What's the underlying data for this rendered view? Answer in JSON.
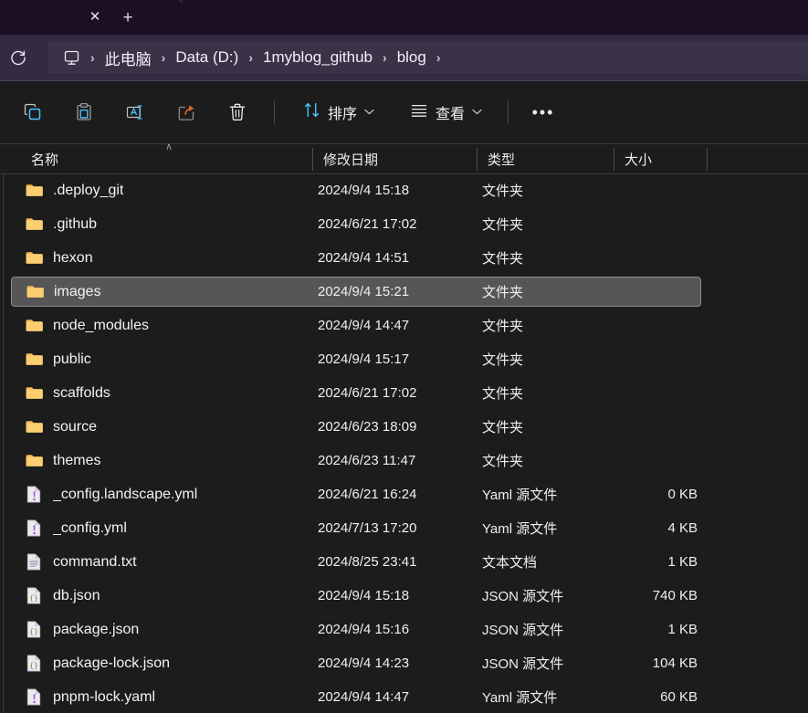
{
  "window": {
    "tab": {
      "close_label": "✕",
      "new_tab_label": "+"
    },
    "address": {
      "refresh_icon": "refresh-icon",
      "pc_icon": "this-pc-monitor-icon",
      "separator": "›",
      "crumbs": [
        "此电脑",
        "Data (D:)",
        "1myblog_github",
        "blog"
      ]
    }
  },
  "toolbar": {
    "icons": [
      {
        "name": "copy-icon",
        "label": "复制"
      },
      {
        "name": "paste-icon",
        "label": "粘贴"
      },
      {
        "name": "rename-icon",
        "label": "重命名"
      },
      {
        "name": "share-icon",
        "label": "共享"
      },
      {
        "name": "delete-icon",
        "label": "删除"
      }
    ],
    "sort_label": "排序",
    "view_label": "查看",
    "more_label": "•••",
    "chevron": "⌄",
    "accent_color": "#4cc2ff"
  },
  "columns": {
    "name": "名称",
    "date_modified": "修改日期",
    "type": "类型",
    "size": "大小",
    "sort_caret": "∧"
  },
  "files": [
    {
      "name": ".deploy_git",
      "date": "2024/9/4 15:18",
      "type": "文件夹",
      "size": "",
      "icon": "folder-icon",
      "selected": false
    },
    {
      "name": ".github",
      "date": "2024/6/21 17:02",
      "type": "文件夹",
      "size": "",
      "icon": "folder-icon",
      "selected": false
    },
    {
      "name": "hexon",
      "date": "2024/9/4 14:51",
      "type": "文件夹",
      "size": "",
      "icon": "folder-icon",
      "selected": false
    },
    {
      "name": "images",
      "date": "2024/9/4 15:21",
      "type": "文件夹",
      "size": "",
      "icon": "folder-icon",
      "selected": true
    },
    {
      "name": "node_modules",
      "date": "2024/9/4 14:47",
      "type": "文件夹",
      "size": "",
      "icon": "folder-icon",
      "selected": false
    },
    {
      "name": "public",
      "date": "2024/9/4 15:17",
      "type": "文件夹",
      "size": "",
      "icon": "folder-icon",
      "selected": false
    },
    {
      "name": "scaffolds",
      "date": "2024/6/21 17:02",
      "type": "文件夹",
      "size": "",
      "icon": "folder-icon",
      "selected": false
    },
    {
      "name": "source",
      "date": "2024/6/23 18:09",
      "type": "文件夹",
      "size": "",
      "icon": "folder-icon",
      "selected": false
    },
    {
      "name": "themes",
      "date": "2024/6/23 11:47",
      "type": "文件夹",
      "size": "",
      "icon": "folder-icon",
      "selected": false
    },
    {
      "name": "_config.landscape.yml",
      "date": "2024/6/21 16:24",
      "type": "Yaml 源文件",
      "size": "0 KB",
      "icon": "yaml-file-icon",
      "selected": false
    },
    {
      "name": "_config.yml",
      "date": "2024/7/13 17:20",
      "type": "Yaml 源文件",
      "size": "4 KB",
      "icon": "yaml-file-icon",
      "selected": false
    },
    {
      "name": "command.txt",
      "date": "2024/8/25 23:41",
      "type": "文本文档",
      "size": "1 KB",
      "icon": "text-file-icon",
      "selected": false
    },
    {
      "name": "db.json",
      "date": "2024/9/4 15:18",
      "type": "JSON 源文件",
      "size": "740 KB",
      "icon": "json-file-icon",
      "selected": false
    },
    {
      "name": "package.json",
      "date": "2024/9/4 15:16",
      "type": "JSON 源文件",
      "size": "1 KB",
      "icon": "json-file-icon",
      "selected": false
    },
    {
      "name": "package-lock.json",
      "date": "2024/9/4 14:23",
      "type": "JSON 源文件",
      "size": "104 KB",
      "icon": "json-file-icon",
      "selected": false
    },
    {
      "name": "pnpm-lock.yaml",
      "date": "2024/9/4 14:47",
      "type": "Yaml 源文件",
      "size": "60 KB",
      "icon": "yaml-file-icon",
      "selected": false
    }
  ]
}
